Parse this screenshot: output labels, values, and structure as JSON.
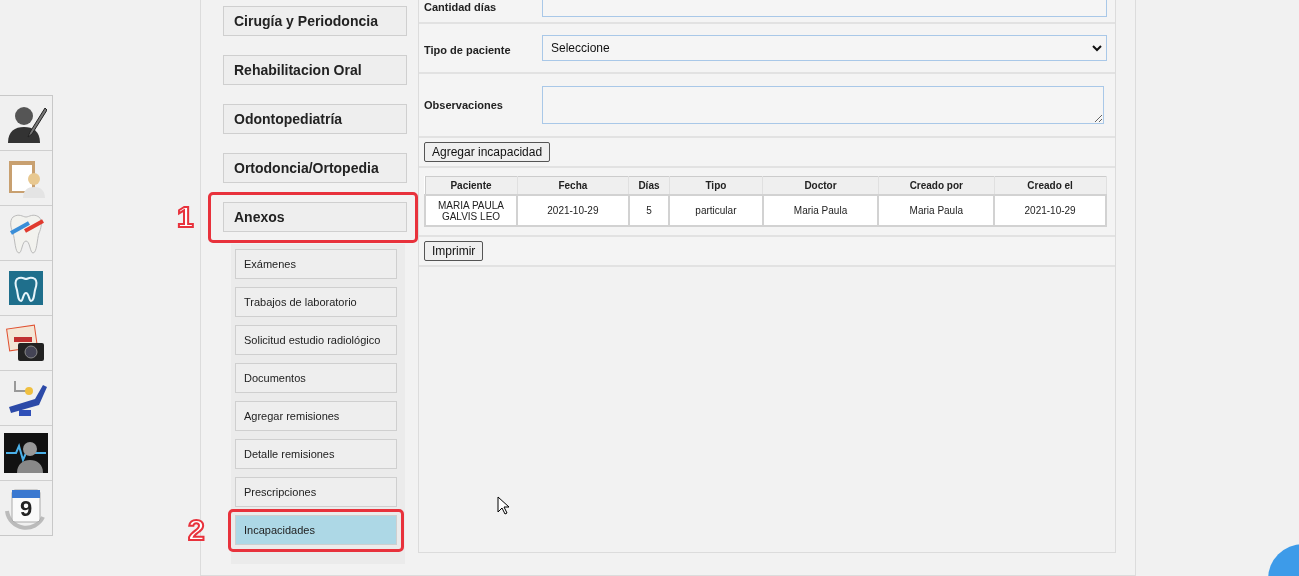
{
  "tools": [
    {
      "kind": "doctor"
    },
    {
      "kind": "clipboard"
    },
    {
      "kind": "tooth"
    },
    {
      "kind": "xray"
    },
    {
      "kind": "photo"
    },
    {
      "kind": "chair"
    },
    {
      "kind": "monitor"
    },
    {
      "kind": "calendar",
      "day": "9"
    }
  ],
  "menu": [
    {
      "label": "Cirugía y Periodoncia"
    },
    {
      "label": "Rehabilitacion Oral"
    },
    {
      "label": "Odontopediatría"
    },
    {
      "label": "Ortodoncia/Ortopedia"
    },
    {
      "label": "Anexos",
      "callout": "1",
      "children": [
        {
          "label": "Exámenes",
          "selected": false
        },
        {
          "label": "Trabajos de laboratorio",
          "selected": false
        },
        {
          "label": "Solicitud estudio radiológico",
          "selected": false
        },
        {
          "label": "Documentos",
          "selected": false
        },
        {
          "label": "Agregar remisiones",
          "selected": false
        },
        {
          "label": "Detalle remisiones",
          "selected": false
        },
        {
          "label": "Prescripciones",
          "selected": false
        },
        {
          "label": "Incapacidades",
          "selected": true,
          "callout": "2"
        }
      ]
    }
  ],
  "form": [
    {
      "kind": "text",
      "label": "Cantidad días"
    },
    {
      "kind": "select",
      "label": "Tipo de paciente",
      "value": "Seleccione"
    },
    {
      "kind": "textarea",
      "label": "Observaciones"
    }
  ],
  "add_button": "Agregar incapacidad",
  "table": {
    "columns": [
      "Paciente",
      "Fecha",
      "Días",
      "Tipo",
      "Doctor",
      "Creado por",
      "Creado el"
    ],
    "rows": [
      [
        "MARIA PAULA GALVIS LEO",
        "2021-10-29",
        "5",
        "particular",
        "Maria Paula",
        "Maria Paula",
        "2021-10-29"
      ]
    ]
  },
  "print_button": "Imprimir"
}
